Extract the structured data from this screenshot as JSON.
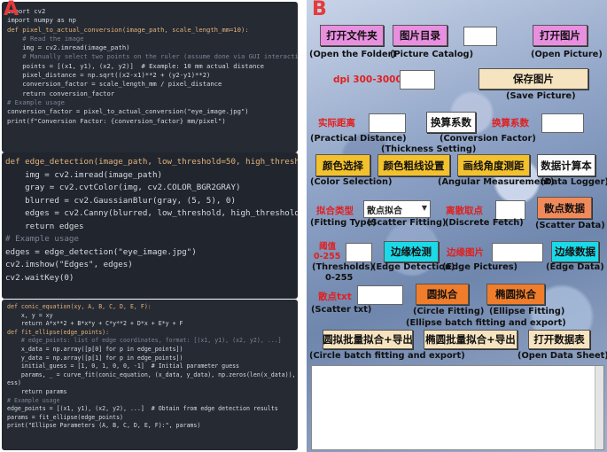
{
  "left": {
    "panel_letter": "A",
    "code_block_1": [
      "import cv2",
      "import numpy as np",
      "",
      "def pixel_to_actual_conversion(image_path, scale_length_mm=10):",
      "    # Read the image",
      "    img = cv2.imread(image_path)",
      "    # Manually select two points on the ruler (assume done via GUI interaction)",
      "    points = [(x1, y1), (x2, y2)]  # Example: 10 mm actual distance",
      "    pixel_distance = np.sqrt((x2-x1)**2 + (y2-y1)**2)",
      "    conversion_factor = scale_length_mm / pixel_distance",
      "    return conversion_factor",
      "",
      "# Example usage",
      "conversion_factor = pixel_to_actual_conversion(\"eye_image.jpg\")",
      "print(f\"Conversion Factor: {conversion_factor} mm/pixel\")"
    ],
    "code_block_2": [
      "def edge_detection(image_path, low_threshold=50, high_threshold=150):",
      "    img = cv2.imread(image_path)",
      "    gray = cv2.cvtColor(img, cv2.COLOR_BGR2GRAY)",
      "    blurred = cv2.GaussianBlur(gray, (5, 5), 0)",
      "    edges = cv2.Canny(blurred, low_threshold, high_threshold)",
      "    return edges",
      "",
      "# Example usage",
      "edges = edge_detection(\"eye_image.jpg\")",
      "cv2.imshow(\"Edges\", edges)",
      "cv2.waitKey(0)"
    ],
    "code_block_3": [
      "def conic_equation(xy, A, B, C, D, E, F):",
      "    x, y = xy",
      "    return A*x**2 + B*x*y + C*y**2 + D*x + E*y + F",
      "",
      "def fit_ellipse(edge_points):",
      "    # edge_points: list of edge coordinates, format: [(x1, y1), (x2, y2), ...]",
      "    x_data = np.array([p[0] for p in edge_points])",
      "    y_data = np.array([p[1] for p in edge_points])",
      "    initial_guess = [1, 0, 1, 0, 0, -1]  # Initial parameter guess",
      "",
      "    params, _ = curve_fit(conic_equation, (x_data, y_data), np.zeros(len(x_data)), p0=initial_gu",
      "ess)",
      "    return params",
      "",
      "# Example usage",
      "edge_points = [(x1, y1), (x2, y2), ...]  # Obtain from edge detection results",
      "params = fit_ellipse(edge_points)",
      "print(\"Ellipse Parameters (A, B, C, D, E, F):\", params)"
    ]
  },
  "right": {
    "panel_letter": "B",
    "open_folder_button": "打开文件夹",
    "open_folder_caption": "(Open the Folder)",
    "picture_catalog_button": "图片目录",
    "picture_catalog_caption": "(Picture Catalog)",
    "open_picture_button": "打开图片",
    "open_picture_caption": "(Open Picture)",
    "dpi_label": "dpi 300-3000",
    "save_picture_button": "保存图片",
    "save_picture_caption": "(Save Picture)",
    "practical_distance_label": "实际距离",
    "practical_distance_caption": "(Practical Distance)",
    "conversion_factor_button": "换算系数",
    "conversion_factor_caption": "(Conversion Factor)",
    "pixel_factor_label": "换算系数",
    "color_selection_button": "颜色选择",
    "color_selection_caption": "(Color Selection)",
    "thickness_setting_button": "颜色粗线设置",
    "thickness_setting_caption": "(Thickness Setting)",
    "angular_measurement_button": "画线角度测距",
    "angular_measurement_caption": "(Angular Measurement)",
    "data_logger_button": "数据计算本",
    "data_logger_caption": "(Data Logger)",
    "fitting_type_label": "拟合类型",
    "fitting_type_caption": "(Fitting Type)",
    "scatter_fitting_value": "散点拟合",
    "scatter_fitting_caption": "(Scatter Fitting)",
    "discrete_fetch_label": "离散取点",
    "discrete_fetch_caption": "(Discrete Fetch)",
    "scatter_data_button": "散点数据",
    "scatter_data_caption": "(Scatter Data)",
    "thresholds_label": "阈值",
    "thresholds_range_label": "0-255",
    "thresholds_caption": "(Thresholds)",
    "thresholds_caption_range": "0-255",
    "edge_detection_button": "边缘检测",
    "edge_detection_caption": "(Edge Detection)",
    "edge_pictures_label": "边缘图片",
    "edge_pictures_caption": "(Edge Pictures)",
    "edge_data_button": "边缘数据",
    "edge_data_caption": "(Edge Data)",
    "scatter_txt_label": "散点txt",
    "scatter_txt_caption": "(Scatter txt)",
    "circle_fitting_button": "圆拟合",
    "circle_fitting_caption": "(Circle Fitting)",
    "ellipse_fitting_button": "椭圆拟合",
    "ellipse_fitting_caption": "(Ellipse Fitting)",
    "ellipse_batch_caption": "(Ellipse batch fitting and export)",
    "circle_batch_button": "圆拟批量拟合+导出",
    "circle_batch_caption": "(Circle batch fitting and export)",
    "ellipse_batch_button": "椭圆批量拟合+导出",
    "open_data_sheet_button": "打开数据表",
    "open_data_sheet_caption": "(Open Data Sheet)"
  }
}
